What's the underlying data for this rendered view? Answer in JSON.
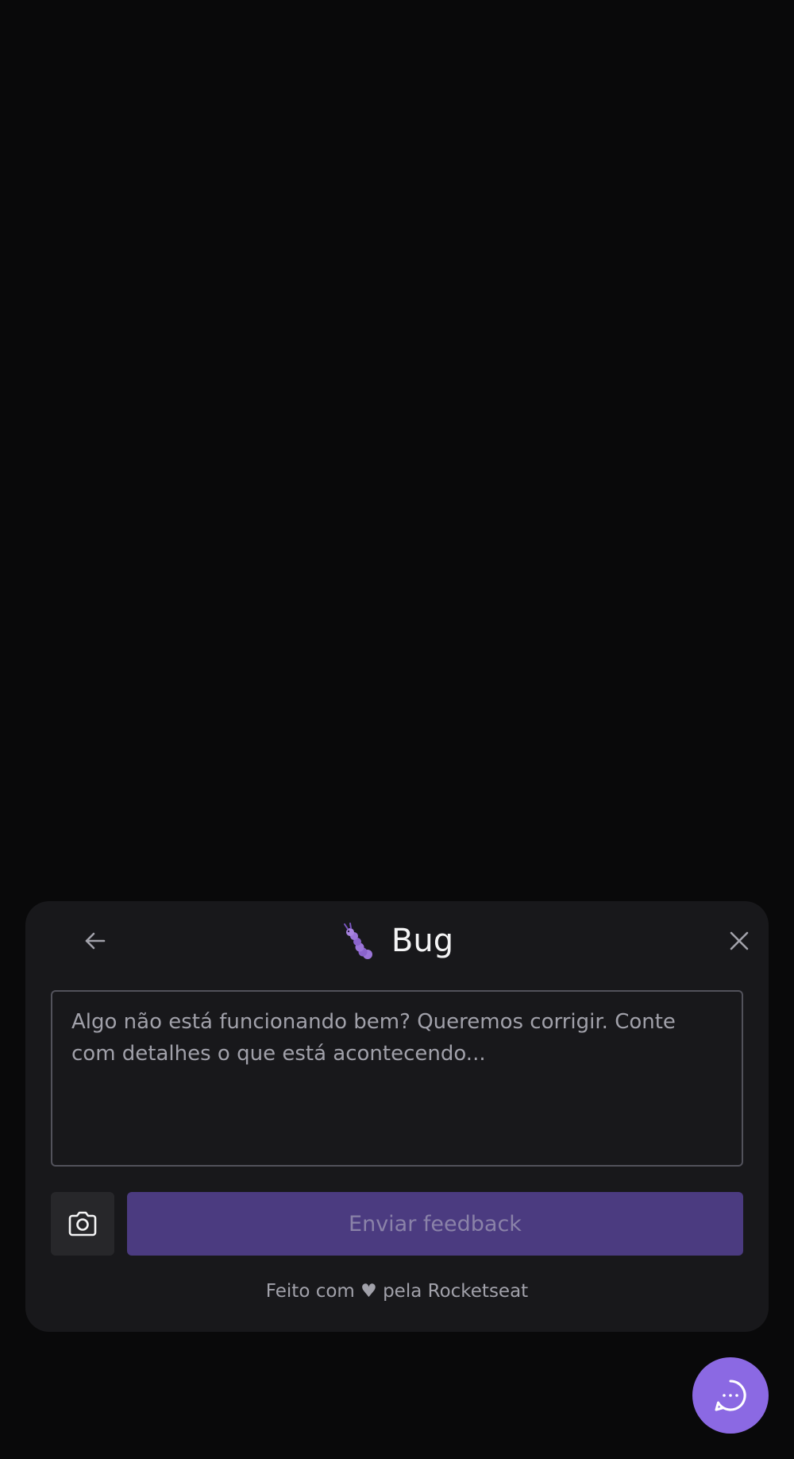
{
  "widget": {
    "title": "Bug",
    "title_icon": "bug-icon",
    "back_icon": "arrow-left-icon",
    "close_icon": "close-icon",
    "textarea": {
      "placeholder": "Algo não está funcionando bem? Queremos corrigir. Conte com detalhes o que está acontecendo...",
      "value": ""
    },
    "screenshot_icon": "camera-icon",
    "submit_label": "Enviar feedback",
    "footer": "Feito com ♥ pela Rocketseat"
  },
  "fab": {
    "icon": "chat-bubble-dots-icon"
  },
  "colors": {
    "background": "#09090a",
    "card": "#18181b",
    "brand": "#8b69e3",
    "submit_disabled": "#4b3b80",
    "screenshot_button": "#27272a"
  }
}
